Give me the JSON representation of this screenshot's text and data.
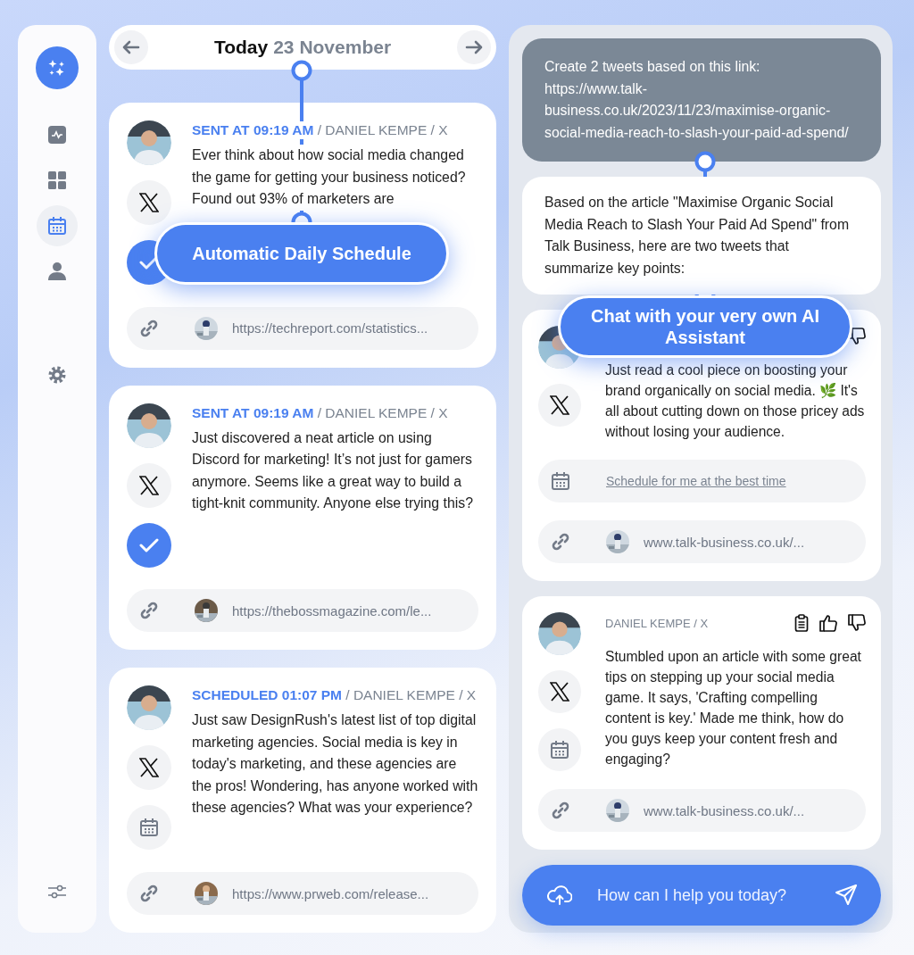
{
  "sidebar": {
    "nav": [
      {
        "selected": false
      },
      {
        "selected": false
      },
      {
        "selected": true
      },
      {
        "selected": false
      }
    ]
  },
  "header": {
    "today": "Today",
    "date": "23 November"
  },
  "posts": [
    {
      "status": "SENT AT 09:19 AM",
      "meta": "/ DANIEL KEMPE / X",
      "text": "Ever think about how social media changed the game for getting your business noticed? Found out 93% of marketers are",
      "sent": true,
      "link": "https://techreport.com/statistics..."
    },
    {
      "status": "SENT AT 09:19 AM",
      "meta": "/ DANIEL KEMPE / X",
      "text": "Just discovered a neat article on using Discord for marketing! It’s not just for gamers anymore. Seems like a great way to build a tight-knit community. Anyone else trying this?",
      "sent": true,
      "link": "https://thebossmagazine.com/le..."
    },
    {
      "status": "SCHEDULED 01:07 PM",
      "meta": "/ DANIEL KEMPE / X",
      "text": "Just saw DesignRush's latest list of top digital marketing agencies. Social media is key in today's marketing, and these agencies are the pros! Wondering, has anyone worked with these agencies? What was your experience?",
      "sent": false,
      "link": "https://www.prweb.com/release..."
    }
  ],
  "chat": {
    "prompt": "Create 2 tweets based on this link: https://www.talk-business.co.uk/2023/11/23/maximise-organic-social-media-reach-to-slash-your-paid-ad-spend/",
    "answer": "Based on the article \"Maximise Organic Social Media Reach to Slash Your Paid Ad Spend\" from Talk Business, here are two tweets that summarize key points:",
    "drafts": [
      {
        "actions": [
          {
            "kind": "dislike"
          }
        ],
        "text": "Just read a cool piece on boosting your brand organically on social media. 🌿 It's all about cutting down on those pricey ads without losing your audience.",
        "scheduled": false,
        "schedule_link": "Schedule for me at the best time",
        "link": "www.talk-business.co.uk/..."
      },
      {
        "meta": "DANIEL KEMPE / X",
        "actions": [
          {
            "kind": "copy"
          },
          {
            "kind": "like"
          },
          {
            "kind": "dislike"
          }
        ],
        "text": "Stumbled upon an article with some great tips on stepping up your social media game. It says, 'Crafting compelling content is key.' Made me think, how do you guys keep your content fresh and engaging?",
        "scheduled": true,
        "link": "www.talk-business.co.uk/..."
      }
    ],
    "input": {
      "placeholder": "How can I help you today?"
    }
  },
  "callouts": [
    {
      "text": "Automatic Daily Schedule"
    },
    {
      "text": "Chat with your very own AI Assistant"
    }
  ]
}
